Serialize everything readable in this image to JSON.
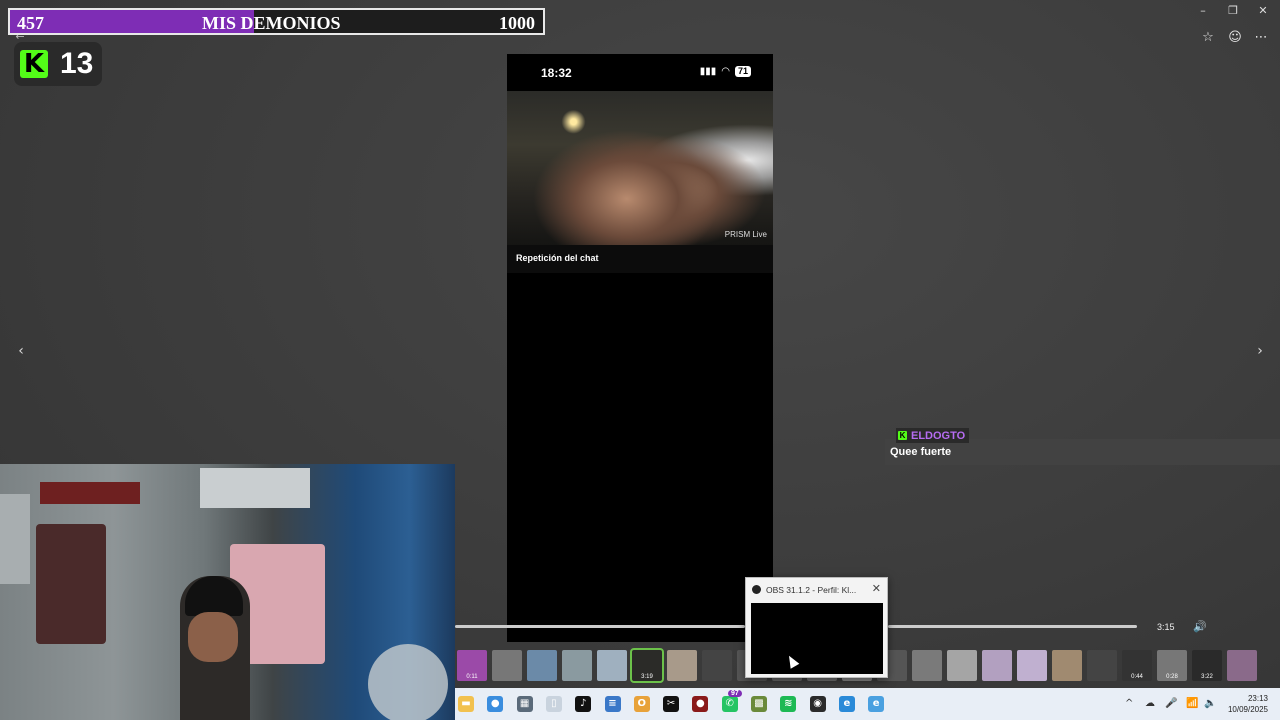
{
  "goal": {
    "current": "457",
    "title": "MIS DEMONIOS",
    "target": "1000",
    "progress": 0.457
  },
  "kick_badge": {
    "logo": "K",
    "count": "13"
  },
  "window": {
    "minimize_icon": "minimize-icon",
    "maximize_icon": "maximize-icon",
    "close_icon": "close-icon",
    "back_icon": "back-arrow-icon",
    "minimize_glyph": "–",
    "maximize_glyph": "❐",
    "close_glyph": "✕",
    "back_glyph": "←",
    "star_glyph": "☆",
    "emoji_glyph": "☺",
    "more_glyph": "⋯"
  },
  "phone": {
    "time": "18:32",
    "signal": "▮▮▮",
    "wifi": "◠",
    "battery": "71",
    "watermark": "PRISM Live",
    "chat_replay_label": "Repetición del chat"
  },
  "navigation": {
    "prev": "‹",
    "next": "›"
  },
  "chat": {
    "username": "ELDOGTO",
    "message": "Quee fuerte",
    "badge": "K",
    "user_color": "#b66cf2"
  },
  "media": {
    "duration": "3:15",
    "volume_glyph": "🔊"
  },
  "thumbnails": [
    {
      "color": "#9b4aa8",
      "dur": "0:11"
    },
    {
      "color": "#777",
      "dur": ""
    },
    {
      "color": "#6b8aa8",
      "dur": ""
    },
    {
      "color": "#8a9aa0",
      "dur": ""
    },
    {
      "color": "#9fb0bf",
      "dur": ""
    },
    {
      "color": "#2b2b28",
      "dur": "3:19",
      "selected": true
    },
    {
      "color": "#a89a8a",
      "dur": ""
    },
    {
      "color": "#444",
      "dur": ""
    },
    {
      "color": "#555",
      "dur": ""
    },
    {
      "color": "#666",
      "dur": ""
    },
    {
      "color": "#6f6f6f",
      "dur": ""
    },
    {
      "color": "#888",
      "dur": ""
    },
    {
      "color": "#555",
      "dur": ""
    },
    {
      "color": "#7a7a7a",
      "dur": ""
    },
    {
      "color": "#a5a5a5",
      "dur": ""
    },
    {
      "color": "#b2a0c0",
      "dur": ""
    },
    {
      "color": "#c0b0d0",
      "dur": ""
    },
    {
      "color": "#a08a70",
      "dur": ""
    },
    {
      "color": "#444",
      "dur": ""
    },
    {
      "color": "#333",
      "dur": "0:44"
    },
    {
      "color": "#777",
      "dur": "0:28"
    },
    {
      "color": "#2a2a2a",
      "dur": "3:22"
    },
    {
      "color": "#8a6a8a",
      "dur": ""
    }
  ],
  "obs": {
    "title": "OBS 31.1.2 - Perfil: Kl...",
    "close_glyph": "✕"
  },
  "taskbar": {
    "icons": [
      {
        "name": "file-explorer-icon",
        "color": "#f2c14e",
        "glyph": "▬"
      },
      {
        "name": "chrome-icon",
        "color": "#3a8dde",
        "glyph": "●"
      },
      {
        "name": "calculator-icon",
        "color": "#5a6a7a",
        "glyph": "▦"
      },
      {
        "name": "file-icon",
        "color": "#c9d3de",
        "glyph": "▯"
      },
      {
        "name": "tiktok-icon",
        "color": "#111",
        "glyph": "♪"
      },
      {
        "name": "notepad-icon",
        "color": "#3a78c8",
        "glyph": "≡"
      },
      {
        "name": "opera-icon",
        "color": "#e8a23a",
        "glyph": "O"
      },
      {
        "name": "capcut-icon",
        "color": "#111",
        "glyph": "✂"
      },
      {
        "name": "record-icon",
        "color": "#8a1a1a",
        "glyph": "●"
      },
      {
        "name": "whatsapp-icon",
        "color": "#25c464",
        "glyph": "✆"
      },
      {
        "name": "minecraft-icon",
        "color": "#6a8a3a",
        "glyph": "▩"
      },
      {
        "name": "spotify-icon",
        "color": "#1db954",
        "glyph": "≋"
      },
      {
        "name": "obs-icon",
        "color": "#2b2b2b",
        "glyph": "◉"
      },
      {
        "name": "edge-icon",
        "color": "#2a8ad8",
        "glyph": "e"
      },
      {
        "name": "edge-beta-icon",
        "color": "#4aa0e0",
        "glyph": "e"
      }
    ],
    "whatsapp_badge": "97",
    "tray": {
      "chevron": "^",
      "cloud": "☁",
      "mic": "🎤",
      "wifi": "📶",
      "volume": "🔈"
    },
    "time": "23:13",
    "date": "10/09/2025"
  }
}
